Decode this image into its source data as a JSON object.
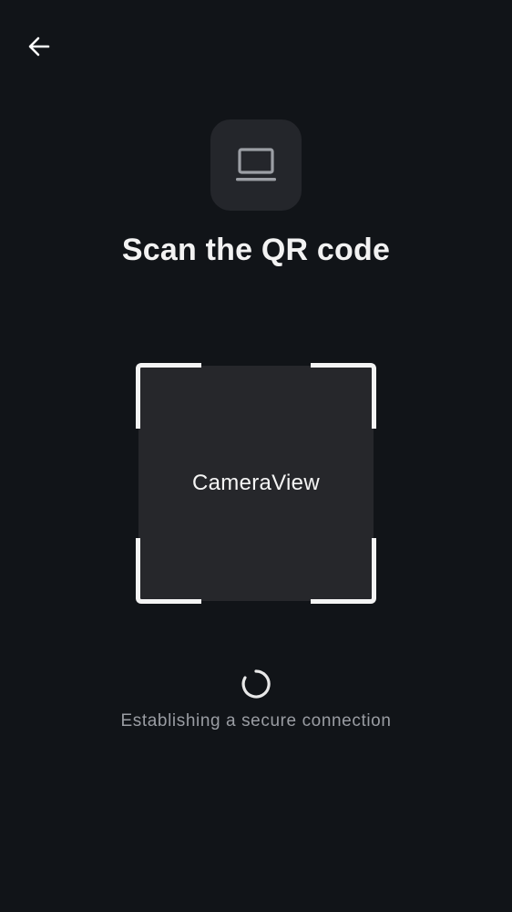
{
  "header": {
    "back_icon": "arrow-left-icon"
  },
  "device": {
    "icon": "laptop-icon"
  },
  "title": "Scan the QR code",
  "camera": {
    "label": "CameraView"
  },
  "status": {
    "icon": "loading-spinner-icon",
    "text": "Establishing a secure connection"
  },
  "colors": {
    "background": "#111418",
    "tile": "#24262b",
    "camera_bg": "#26272b",
    "frame": "#f4f4f4",
    "muted_text": "#9a9da3"
  }
}
